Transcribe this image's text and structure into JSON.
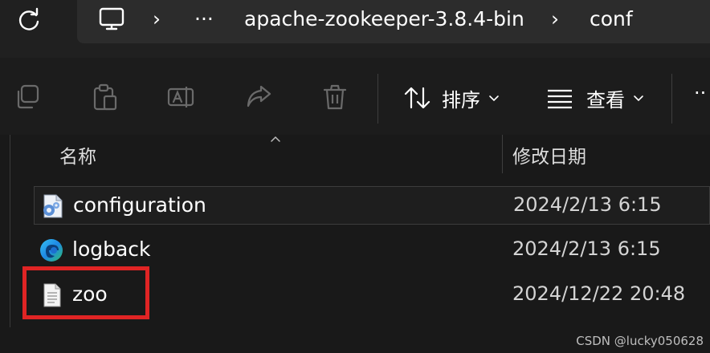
{
  "address_bar": {
    "breadcrumbs": [
      {
        "label": "apache-zookeeper-3.8.4-bin"
      },
      {
        "label": "conf"
      }
    ],
    "overflow_label": "···",
    "separator": "›"
  },
  "toolbar": {
    "sort_label": "排序",
    "view_label": "查看",
    "more_label": "··"
  },
  "columns": {
    "name": "名称",
    "modified": "修改日期"
  },
  "files": [
    {
      "name": "configuration",
      "modified": "2024/2/13 6:15",
      "icon": "xsl-document-icon"
    },
    {
      "name": "logback",
      "modified": "2024/2/13 6:15",
      "icon": "edge-icon"
    },
    {
      "name": "zoo",
      "modified": "2024/12/22 20:48",
      "icon": "text-file-icon"
    }
  ],
  "colors": {
    "highlight": "#e02424",
    "background": "#191919"
  },
  "watermark": "CSDN @lucky050628"
}
